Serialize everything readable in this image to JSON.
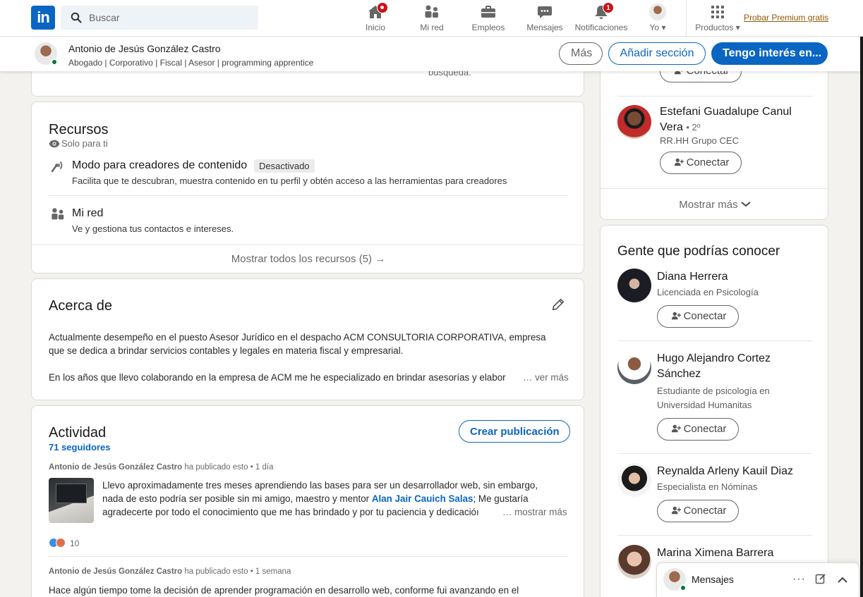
{
  "nav": {
    "search_placeholder": "Buscar",
    "items": [
      {
        "label": "Inicio",
        "icon": "home-icon"
      },
      {
        "label": "Mi red",
        "icon": "network-icon"
      },
      {
        "label": "Empleos",
        "icon": "briefcase-icon"
      },
      {
        "label": "Mensajes",
        "icon": "messaging-icon"
      },
      {
        "label": "Notificaciones",
        "icon": "bell-icon",
        "badge": "1"
      },
      {
        "label": "Yo",
        "icon": "me-avatar"
      },
      {
        "label": "Productos",
        "icon": "grid-icon"
      }
    ],
    "premium": "Probar Premium gratis",
    "brand_color": "#0a66c2"
  },
  "profile_bar": {
    "name": "Antonio de Jesús González Castro",
    "headline": "Abogado | Corporativo | Fiscal | Asesor | programming apprentice",
    "more": "Más",
    "add_section": "Añadir sección",
    "open_to": "Tengo interés en..."
  },
  "top_card": {
    "fragment": "búsqueda."
  },
  "resources": {
    "title": "Recursos",
    "visibility": "Solo para ti",
    "items": [
      {
        "title": "Modo para creadores de contenido",
        "pill": "Desactivado",
        "desc": "Facilita que te descubran, muestra contenido en tu perfil y obtén acceso a las herramientas para creadores"
      },
      {
        "title": "Mi red",
        "desc": "Ve y gestiona tus contactos e intereses."
      }
    ],
    "show_all": "Mostrar todos los recursos (5) →"
  },
  "about": {
    "title": "Acerca de",
    "p1_line1": "Actualmente desempeño en el puesto Asesor Jurídico en el despacho ACM CONSULTORIA CORPORATIVA, empresa",
    "p1_line2": "que se dedica a brindar servicios contables y legales en materia fiscal y empresarial.",
    "p2_line": "En los años que llevo colaborando en la empresa de ACM me he especializado en brindar asesorías y elabor",
    "see_more": "… ver más"
  },
  "activity": {
    "title": "Actividad",
    "followers": "71 seguidores",
    "create_post": "Crear publicación",
    "posts": [
      {
        "author": "Antonio de Jesús González Castro",
        "meta": "ha publicado esto • 1 día",
        "line1": "Llevo aproximadamente tres meses aprendiendo las bases para ser un desarrollador web, sin embargo,",
        "line2_pre": "nada de esto podría ser posible sin mi amigo, maestro y mentor ",
        "mention": "Alan Jair Cauich Salas",
        "line2_post": "; Me gustaría",
        "line3": "agradecerte por todo el conocimiento que me has brindado y por tu paciencia y dedicacióı",
        "see_more": "… mostrar más",
        "reactions": "10"
      },
      {
        "author": "Antonio de Jesús González Castro",
        "meta": "ha publicado esto • 1 semana",
        "line1": "Hace algún tiempo tome la decisión de aprender programación en desarrollo web, conforme fui avanzando en el"
      }
    ]
  },
  "sidebar_top": {
    "partial_button": "Conectar",
    "person": {
      "name_line1": "Estefani Guadalupe Canul",
      "name_line2": "Vera",
      "degree": "• 2º",
      "subtitle": "RR.HH Grupo CEC",
      "button": "Conectar"
    },
    "show_more": "Mostrar más"
  },
  "people": {
    "title": "Gente que podrías conocer",
    "list": [
      {
        "name": "Diana Herrera",
        "sub1": "Licenciada en Psicología",
        "button": "Conectar"
      },
      {
        "name1": "Hugo Alejandro Cortez",
        "name2": "Sánchez",
        "sub1": "Estudiante de psicología en",
        "sub2": "Universidad Humanitas",
        "button": "Conectar"
      },
      {
        "name": "Reynalda Arleny Kauil Diaz",
        "sub1": "Especialista en Nóminas",
        "button": "Conectar"
      },
      {
        "name": "Marina Ximena Barrera"
      }
    ]
  },
  "messaging": {
    "label": "Mensajes"
  }
}
